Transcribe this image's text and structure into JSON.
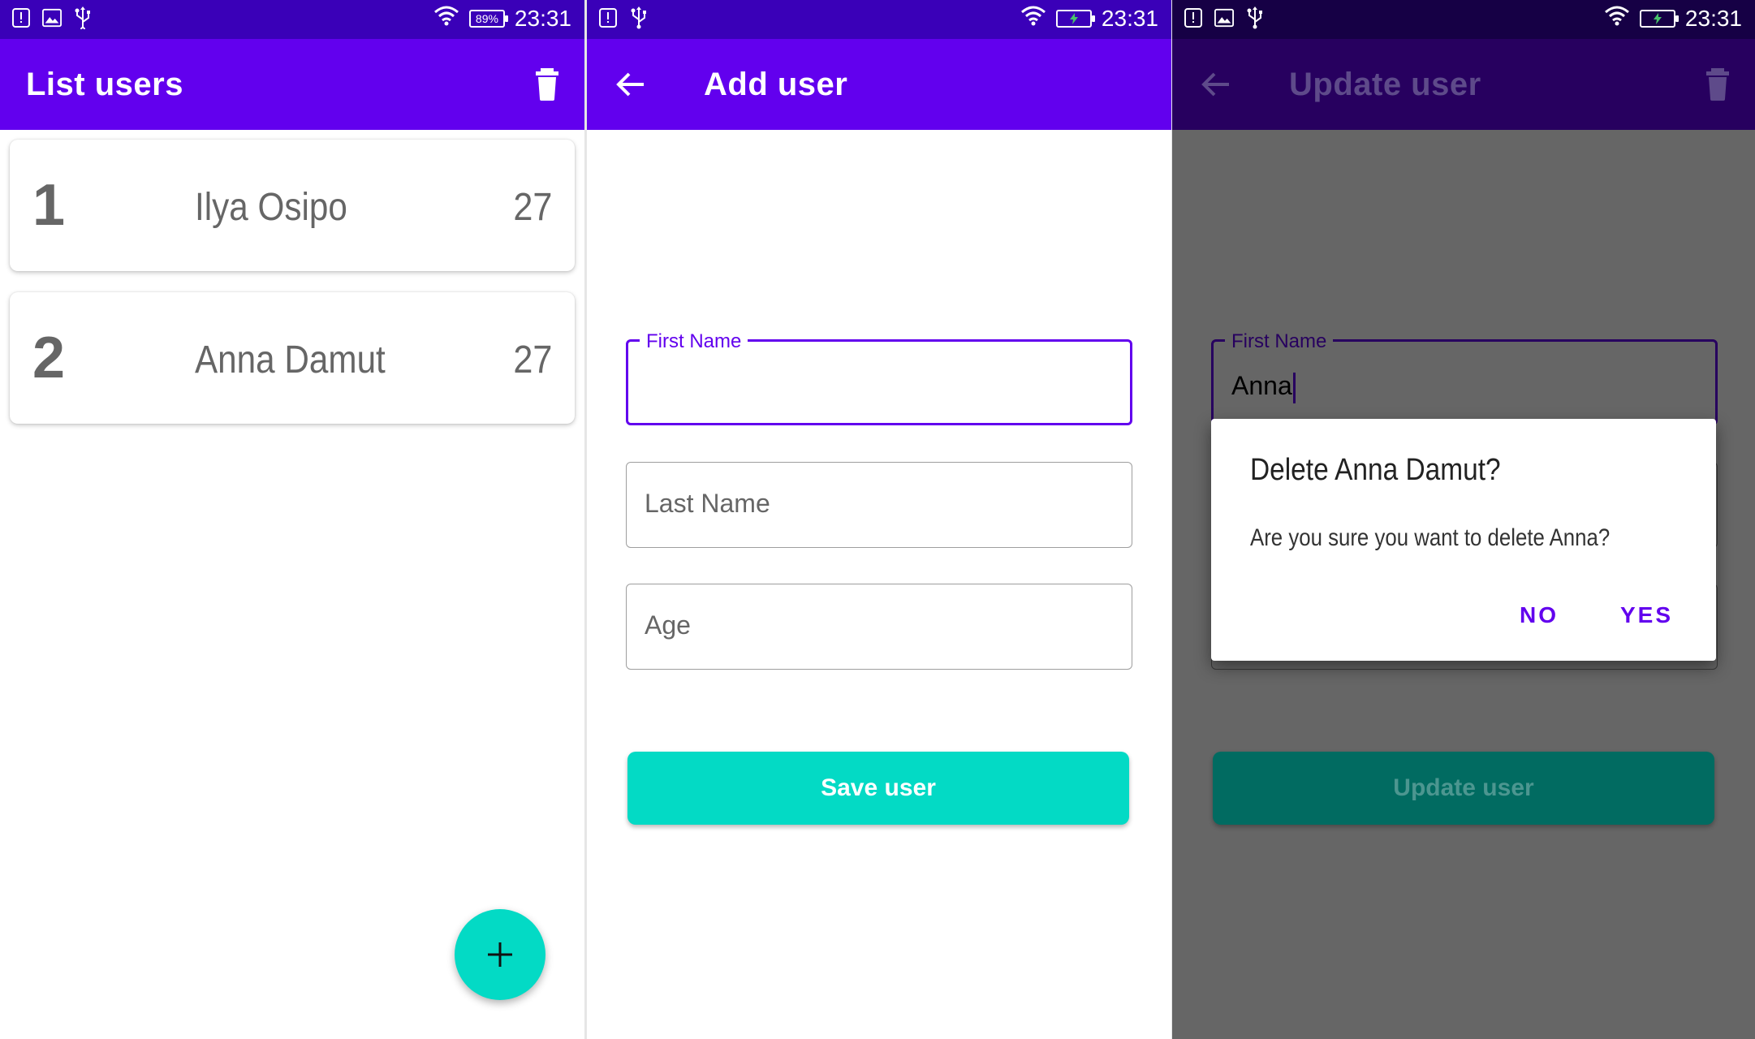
{
  "status_bar": {
    "time": "23:31",
    "battery_level": "89%"
  },
  "list_screen": {
    "title": "List users",
    "users": [
      {
        "id": "1",
        "name": "Ilya Osipo",
        "age": "27"
      },
      {
        "id": "2",
        "name": "Anna Damut",
        "age": "27"
      }
    ],
    "fab_icon": "plus-icon"
  },
  "add_screen": {
    "title": "Add user",
    "fields": {
      "first_name_label": "First Name",
      "last_name_hint": "Last Name",
      "age_hint": "Age"
    },
    "save_label": "Save user"
  },
  "update_screen": {
    "title": "Update user",
    "first_name_label": "First Name",
    "first_name_value": "Anna",
    "update_label": "Update user",
    "dialog": {
      "title": "Delete Anna Damut?",
      "message": "Are you sure you want to delete Anna?",
      "no_label": "NO",
      "yes_label": "YES"
    }
  },
  "colors": {
    "primary": "#6200ee",
    "status_bar": "#3a00b8",
    "accent": "#03dac5",
    "scrim": "#666666"
  }
}
